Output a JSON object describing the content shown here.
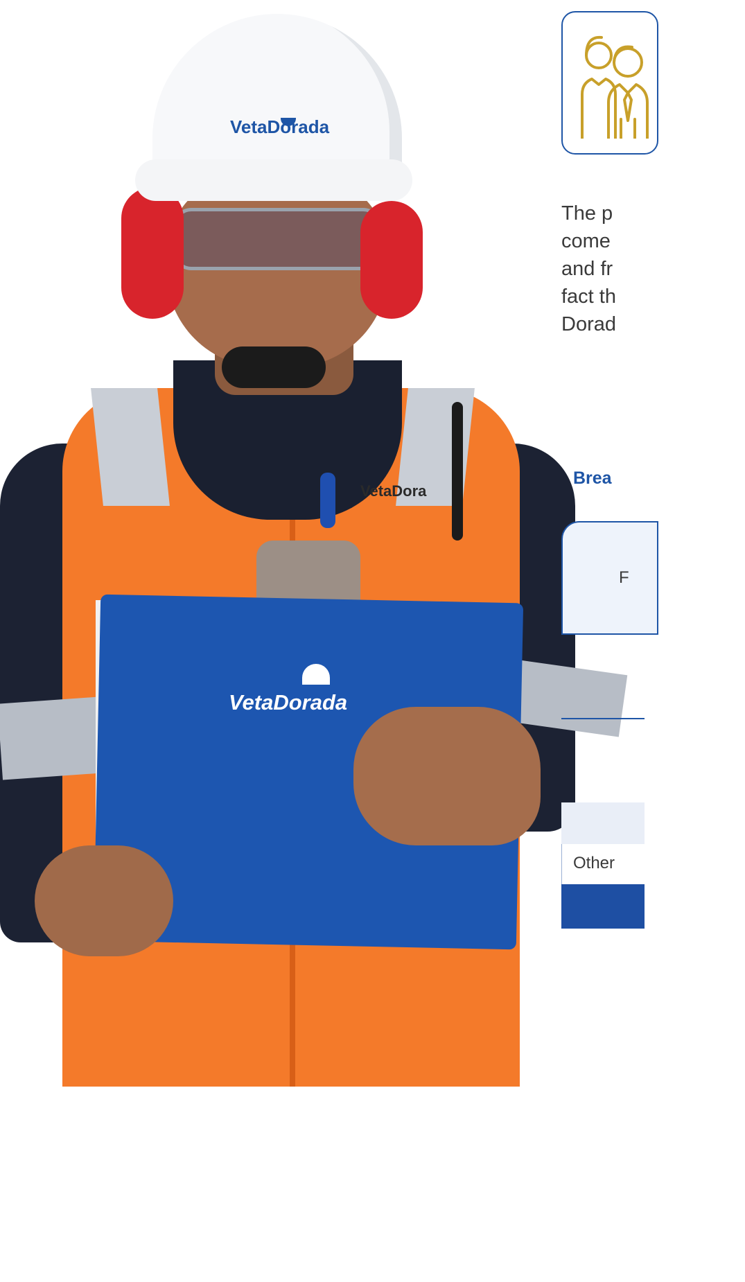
{
  "colors": {
    "brand_blue": "#1e55a6",
    "accent_gold": "#c8a02a",
    "text_gray": "#3a3a3a"
  },
  "photo": {
    "helmet_logo": "VetaDorada",
    "vest_logo": "VetaDora",
    "clipboard_logo": "VetaDorada"
  },
  "icon": {
    "name": "people-group-icon"
  },
  "intro_lines": [
    "The p",
    "come",
    "and fr",
    "fact th",
    "Dorad"
  ],
  "section": {
    "heading": "Brea"
  },
  "table": {
    "header_text": "F",
    "row_label": "Other"
  }
}
